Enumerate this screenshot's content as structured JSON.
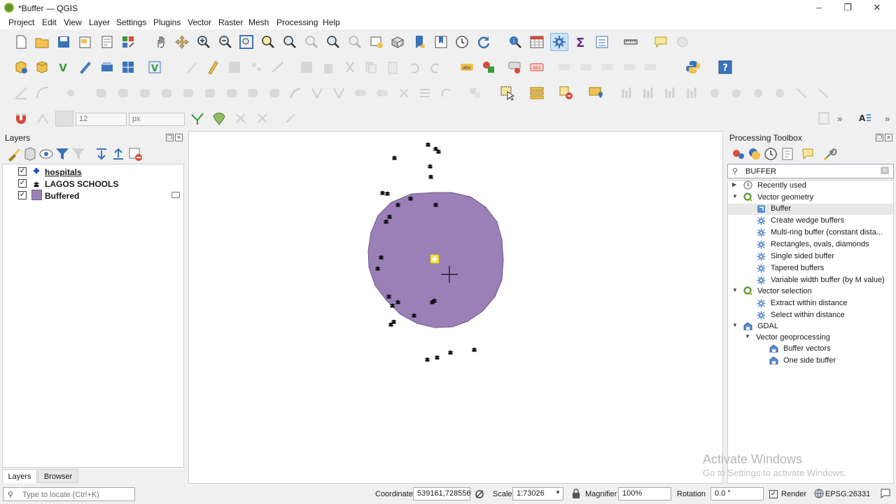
{
  "window": {
    "title": "*Buffer — QGIS",
    "minimize": "–",
    "maximize": "❐",
    "close": "✕"
  },
  "menu": [
    "Project",
    "Edit",
    "View",
    "Layer",
    "Settings",
    "Plugins",
    "Vector",
    "Raster",
    "Mesh",
    "Processing",
    "Help"
  ],
  "digitize_toolbar": {
    "font_size_value": "12",
    "unit_value": "px"
  },
  "layers_panel": {
    "title": "Layers",
    "layers": [
      {
        "name": "hospitals",
        "checked": true,
        "symbol": "hospital-cross"
      },
      {
        "name": "LAGOS SCHOOLS",
        "checked": true,
        "symbol": "school-marker"
      },
      {
        "name": "Buffered",
        "checked": true,
        "symbol": "purple-fill",
        "color": "#9b7fb7"
      }
    ],
    "tabs": [
      "Layers",
      "Browser"
    ],
    "locator_placeholder": "Type to locate (Ctrl+K)"
  },
  "map": {
    "buffer_color": "#9b7fb7",
    "hospital_color": "#f5e642"
  },
  "processing_toolbox": {
    "title": "Processing Toolbox",
    "search_value": "BUFFER",
    "tree": [
      {
        "label": "Recently used",
        "kind": "group",
        "icon": "clock-icon"
      },
      {
        "label": "Vector geometry",
        "kind": "group",
        "icon": "qgis-icon"
      },
      {
        "label": "Buffer",
        "kind": "algorithm",
        "selected": true
      },
      {
        "label": "Create wedge buffers",
        "kind": "algorithm"
      },
      {
        "label": "Multi-ring buffer (constant dista...",
        "kind": "algorithm"
      },
      {
        "label": "Rectangles, ovals, diamonds",
        "kind": "algorithm"
      },
      {
        "label": "Single sided buffer",
        "kind": "algorithm"
      },
      {
        "label": "Tapered buffers",
        "kind": "algorithm"
      },
      {
        "label": "Variable width buffer (by M value)",
        "kind": "algorithm"
      },
      {
        "label": "Vector selection",
        "kind": "group",
        "icon": "qgis-icon"
      },
      {
        "label": "Extract within distance",
        "kind": "algorithm"
      },
      {
        "label": "Select within distance",
        "kind": "algorithm"
      },
      {
        "label": "GDAL",
        "kind": "provider",
        "icon": "gdal-icon"
      },
      {
        "label": "Vector geoprocessing",
        "kind": "subgroup"
      },
      {
        "label": "Buffer vectors",
        "kind": "gdal-algorithm"
      },
      {
        "label": "One side buffer",
        "kind": "gdal-algorithm"
      }
    ]
  },
  "statusbar": {
    "coordinate_label": "Coordinate",
    "coordinate_value": "539161,728556",
    "scale_label": "Scale",
    "scale_value": "1:73026",
    "magnifier_label": "Magnifier",
    "magnifier_value": "100%",
    "rotation_label": "Rotation",
    "rotation_value": "0.0 °",
    "render_label": "Render",
    "crs_label": "EPSG:26331"
  },
  "watermark": {
    "line1": "Activate Windows",
    "line2": "Go to Settings to activate Windows."
  }
}
